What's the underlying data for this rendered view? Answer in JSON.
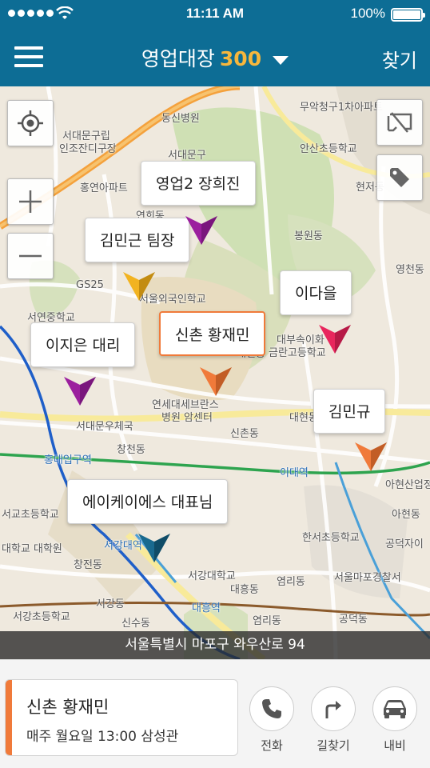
{
  "status_bar": {
    "time": "11:11 AM",
    "battery": "100%"
  },
  "header": {
    "title": "영업대장",
    "count": "300",
    "find_label": "찾기"
  },
  "map": {
    "labels": [
      {
        "text": "동신병원",
        "cls": ""
      },
      {
        "text": "서대문구립",
        "cls": ""
      },
      {
        "text": "인조잔디구장",
        "cls": ""
      },
      {
        "text": "홍연아파트",
        "cls": ""
      },
      {
        "text": "서대문구",
        "cls": ""
      },
      {
        "text": "무악청구1차아파트",
        "cls": ""
      },
      {
        "text": "안산초등학교",
        "cls": ""
      },
      {
        "text": "현저동",
        "cls": ""
      },
      {
        "text": "봉원동",
        "cls": ""
      },
      {
        "text": "영천동",
        "cls": ""
      },
      {
        "text": "연희동",
        "cls": ""
      },
      {
        "text": "GS25",
        "cls": ""
      },
      {
        "text": "서연중학교",
        "cls": ""
      },
      {
        "text": "서울외국인학교",
        "cls": ""
      },
      {
        "text": "대부속이화",
        "cls": ""
      },
      {
        "text": "금란고등학교",
        "cls": ""
      },
      {
        "text": "대신동",
        "cls": ""
      },
      {
        "text": "연세대세브란스",
        "cls": ""
      },
      {
        "text": "병원 암센터",
        "cls": ""
      },
      {
        "text": "대현동",
        "cls": ""
      },
      {
        "text": "서대문우체국",
        "cls": ""
      },
      {
        "text": "창천동",
        "cls": ""
      },
      {
        "text": "신촌동",
        "cls": ""
      },
      {
        "text": "홍대입구역",
        "cls": "blue"
      },
      {
        "text": "이대역",
        "cls": "blue"
      },
      {
        "text": "아현산업정",
        "cls": ""
      },
      {
        "text": "아현동",
        "cls": ""
      },
      {
        "text": "공덕자이",
        "cls": ""
      },
      {
        "text": "서교초등학교",
        "cls": ""
      },
      {
        "text": "한서초등학교",
        "cls": ""
      },
      {
        "text": "대학교 대학원",
        "cls": ""
      },
      {
        "text": "서강대역",
        "cls": "blue"
      },
      {
        "text": "창전동",
        "cls": ""
      },
      {
        "text": "서강대학교",
        "cls": ""
      },
      {
        "text": "대흥동",
        "cls": ""
      },
      {
        "text": "염리동",
        "cls": ""
      },
      {
        "text": "서울마포경찰서",
        "cls": ""
      },
      {
        "text": "서강동",
        "cls": ""
      },
      {
        "text": "대흥역",
        "cls": "blue"
      },
      {
        "text": "서강초등학교",
        "cls": ""
      },
      {
        "text": "신수동",
        "cls": ""
      },
      {
        "text": "염리동",
        "cls": ""
      },
      {
        "text": "공덕동",
        "cls": ""
      }
    ],
    "pins": [
      {
        "id": "pin-sales2",
        "label": "영업2 장희진",
        "color": "#9b1f9e",
        "active": false
      },
      {
        "id": "pin-kimmingeun",
        "label": "김민근 팀장",
        "color": "#f2b320",
        "active": false
      },
      {
        "id": "pin-idaeul",
        "label": "이다을",
        "color": "#e8265d",
        "active": false
      },
      {
        "id": "pin-leejieun",
        "label": "이지은 대리",
        "color": "#9b1f9e",
        "active": false
      },
      {
        "id": "pin-sinchon",
        "label": "신촌 황재민",
        "color": "#f07a3a",
        "active": true
      },
      {
        "id": "pin-kimmingyu",
        "label": "김민규",
        "color": "#f07a3a",
        "active": false
      },
      {
        "id": "pin-akas",
        "label": "에이케이에스 대표님",
        "color": "#1a6a8f",
        "active": false
      }
    ],
    "address": "서울특별시 마포구 와우산로 94"
  },
  "selected": {
    "name": "신촌 황재민",
    "detail": "매주 월요일 13:00 삼성관",
    "accent": "#f07a3a"
  },
  "actions": [
    {
      "label": "전화",
      "icon": "phone-icon"
    },
    {
      "label": "길찾기",
      "icon": "directions-icon"
    },
    {
      "label": "내비",
      "icon": "car-icon"
    }
  ]
}
